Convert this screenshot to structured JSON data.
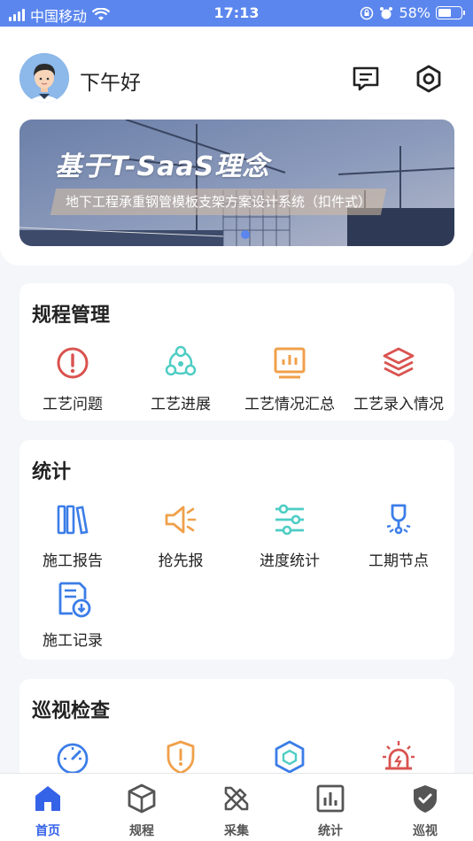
{
  "status_bar": {
    "carrier": "中国移动",
    "time": "17:13",
    "battery": "58%",
    "battery_level": 0.58
  },
  "header": {
    "greeting": "下午好"
  },
  "banner": {
    "title": "基于T-SaaS理念",
    "subtitle": "地下工程承重钢管模板支架方案设计系统（扣件式）"
  },
  "sections": [
    {
      "title": "规程管理",
      "items": [
        {
          "label": "工艺问题",
          "icon": "alert-circle-icon"
        },
        {
          "label": "工艺进展",
          "icon": "network-icon"
        },
        {
          "label": "工艺情况汇总",
          "icon": "chart-board-icon"
        },
        {
          "label": "工艺录入情况",
          "icon": "layers-icon"
        }
      ]
    },
    {
      "title": "统计",
      "items": [
        {
          "label": "施工报告",
          "icon": "books-icon"
        },
        {
          "label": "抢先报",
          "icon": "speaker-icon"
        },
        {
          "label": "进度统计",
          "icon": "sliders-icon"
        },
        {
          "label": "工期节点",
          "icon": "lamp-icon"
        },
        {
          "label": "施工记录",
          "icon": "document-download-icon"
        }
      ]
    },
    {
      "title": "巡视检查",
      "items": [
        {
          "label": "",
          "icon": "speedometer-icon"
        },
        {
          "label": "",
          "icon": "shield-alert-icon"
        },
        {
          "label": "",
          "icon": "hexagon-icon"
        },
        {
          "label": "",
          "icon": "siren-icon"
        }
      ]
    }
  ],
  "tabbar": [
    {
      "label": "首页",
      "icon": "home-icon",
      "active": true
    },
    {
      "label": "规程",
      "icon": "cube-icon"
    },
    {
      "label": "采集",
      "icon": "tools-icon"
    },
    {
      "label": "统计",
      "icon": "bar-chart-icon"
    },
    {
      "label": "巡视",
      "icon": "shield-check-icon"
    }
  ],
  "colors": {
    "accent": "#3563e8",
    "statusbar": "#5b86ee",
    "red": "#d9534f",
    "teal": "#4ecdc4",
    "orange": "#f0a04b",
    "blue": "#3b7de8"
  }
}
